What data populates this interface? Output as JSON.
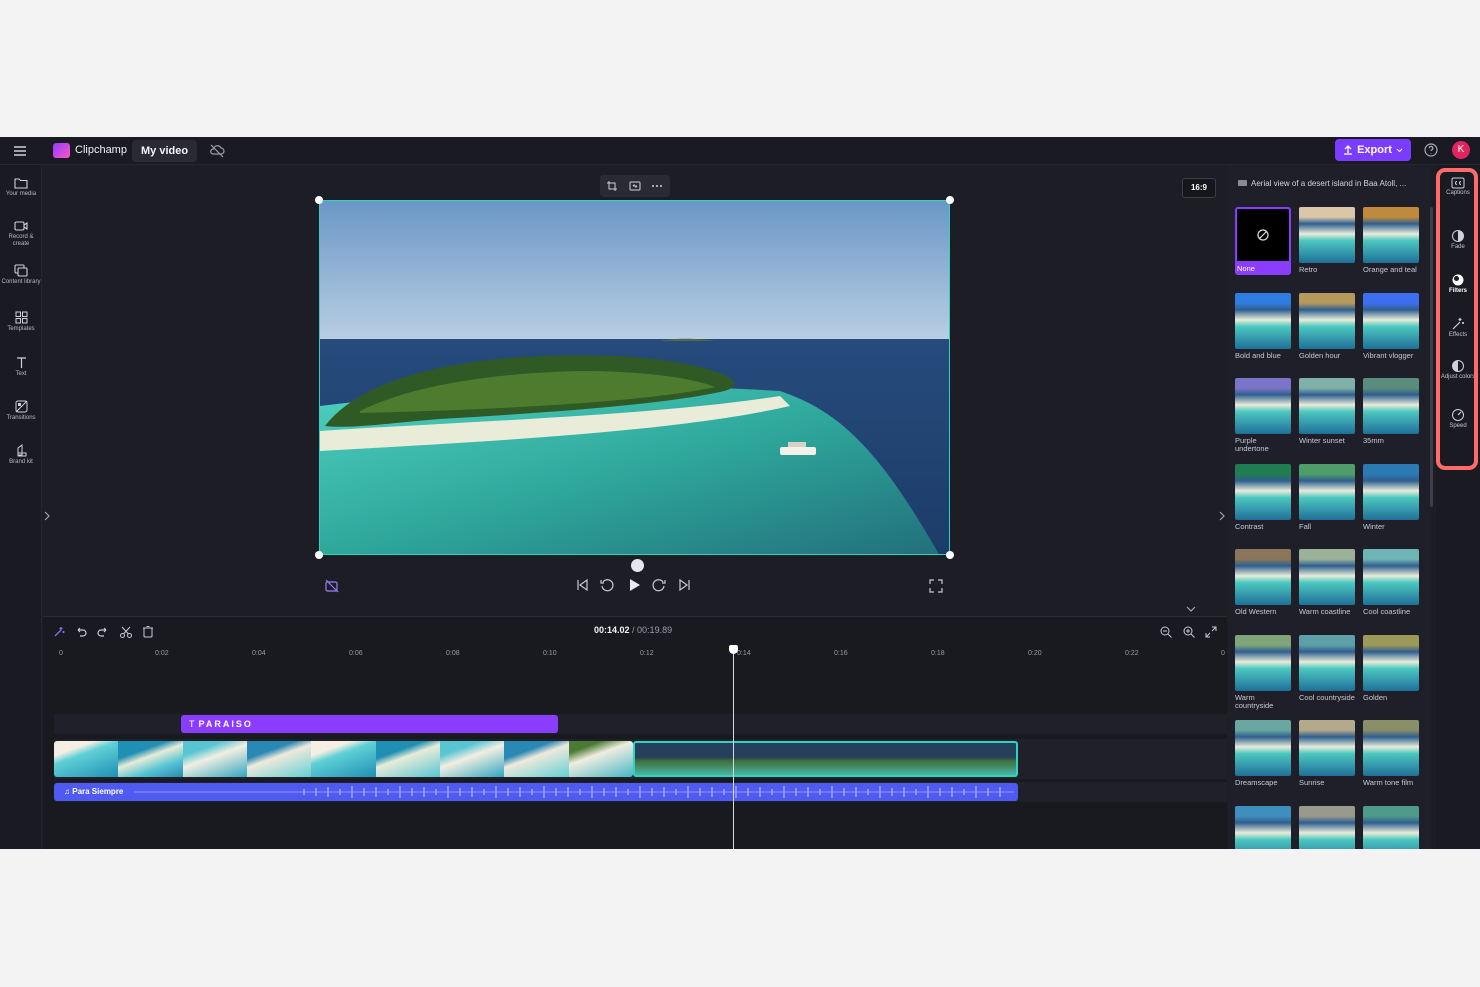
{
  "header": {
    "brand": "Clipchamp",
    "project_name": "My video",
    "export_label": "Export",
    "avatar_initial": "K",
    "accent": "#7b3cff"
  },
  "left_sidebar": [
    {
      "label": "Your media",
      "icon": "folder-icon"
    },
    {
      "label": "Record & create",
      "icon": "camera-icon"
    },
    {
      "label": "Content library",
      "icon": "library-icon"
    },
    {
      "label": "Templates",
      "icon": "templates-icon"
    },
    {
      "label": "Text",
      "icon": "text-icon"
    },
    {
      "label": "Transitions",
      "icon": "transitions-icon"
    },
    {
      "label": "Brand kit",
      "icon": "brand-kit-icon"
    }
  ],
  "preview": {
    "aspect_ratio": "16:9"
  },
  "timeline": {
    "current_time": "00:14.02",
    "total_time": "/ 00:19.89",
    "ticks": [
      "0",
      "0:02",
      "0:04",
      "0:06",
      "0:08",
      "0:10",
      "0:12",
      "0:14",
      "0:16",
      "0:18",
      "0:20",
      "0:22",
      "0"
    ],
    "text_clip": "PARAISO",
    "audio_clip": "Para Siempre"
  },
  "filters_panel": {
    "clip_title": "Aerial view of a desert island in Baa Atoll, ...",
    "selected": "None",
    "filters": [
      {
        "name": "None",
        "tint": "#000000"
      },
      {
        "name": "Retro",
        "tint": "#d9c7a8"
      },
      {
        "name": "Orange and teal",
        "tint": "#c08a3c"
      },
      {
        "name": "Bold and blue",
        "tint": "#2f7de0"
      },
      {
        "name": "Golden hour",
        "tint": "#b59a5c"
      },
      {
        "name": "Vibrant vlogger",
        "tint": "#3e6ff0"
      },
      {
        "name": "Purple undertone",
        "tint": "#7c74c9"
      },
      {
        "name": "Winter sunset",
        "tint": "#7fb0a9"
      },
      {
        "name": "35mm",
        "tint": "#5a8d7c"
      },
      {
        "name": "Contrast",
        "tint": "#1f7d4f"
      },
      {
        "name": "Fall",
        "tint": "#4f9e6a"
      },
      {
        "name": "Winter",
        "tint": "#2b7ab3"
      },
      {
        "name": "Old Western",
        "tint": "#8a765a"
      },
      {
        "name": "Warm coastline",
        "tint": "#9bb19a"
      },
      {
        "name": "Cool coastline",
        "tint": "#6fb5b6"
      },
      {
        "name": "Warm countryside",
        "tint": "#7fa57b"
      },
      {
        "name": "Cool countryside",
        "tint": "#5f9fa8"
      },
      {
        "name": "Golden",
        "tint": "#9c9a58"
      },
      {
        "name": "Dreamscape",
        "tint": "#6aa7a0"
      },
      {
        "name": "Sunrise",
        "tint": "#b4a98a"
      },
      {
        "name": "Warm tone film",
        "tint": "#8a8f68"
      },
      {
        "name": "",
        "tint": "#3f8fbe"
      },
      {
        "name": "",
        "tint": "#9a9a8c"
      },
      {
        "name": "",
        "tint": "#4e9b8a"
      }
    ]
  },
  "right_sidebar": [
    {
      "label": "Captions",
      "icon": "captions-icon"
    },
    {
      "label": "Fade",
      "icon": "fade-icon"
    },
    {
      "label": "Filters",
      "icon": "filters-icon"
    },
    {
      "label": "Effects",
      "icon": "effects-icon"
    },
    {
      "label": "Adjust colors",
      "icon": "adjust-colors-icon"
    },
    {
      "label": "Speed",
      "icon": "speed-icon"
    }
  ]
}
